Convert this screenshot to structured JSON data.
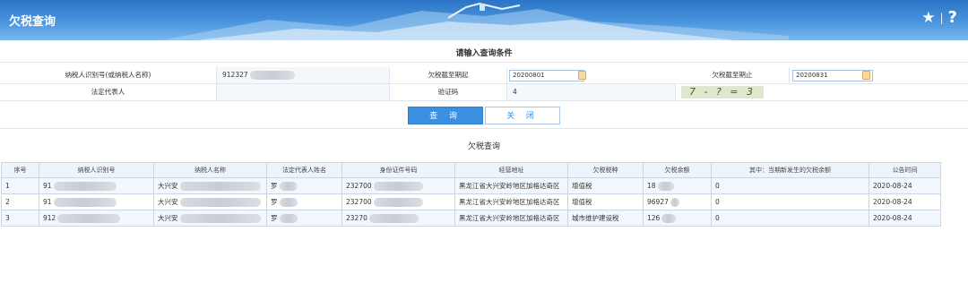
{
  "header": {
    "title": "欠税查询"
  },
  "query": {
    "section_title": "请输入查询条件",
    "taxpayer_id_label": "纳税人识别号(或纳税人名称)",
    "taxpayer_id_value": "912327",
    "date_from_label": "欠税截至期起",
    "date_from_value": "20200801",
    "date_to_label": "欠税截至期止",
    "date_to_value": "20200831",
    "legal_rep_label": "法定代表人",
    "legal_rep_value": "",
    "captcha_label": "验证码",
    "captcha_value": "4",
    "captcha_image_text": "7 - ? = 3"
  },
  "buttons": {
    "query": "查 询",
    "close": "关 闭"
  },
  "results": {
    "title": "欠税查询",
    "columns": [
      "序号",
      "纳税人识别号",
      "纳税人名称",
      "法定代表人姓名",
      "身份证件号码",
      "经营地址",
      "欠税税种",
      "欠税余额",
      "其中：当期新发生的欠税余额",
      "公告时间"
    ],
    "rows": [
      {
        "no": "1",
        "taxpayer_id": "91",
        "name": "大兴安",
        "legal_rep": "罗",
        "id_number": "232700",
        "address": "黑龙江省大兴安岭地区加格达奇区",
        "tax_type": "增值税",
        "balance": "18",
        "current_balance": "0",
        "date": "2020-08-24"
      },
      {
        "no": "2",
        "taxpayer_id": "91",
        "name": "大兴安",
        "legal_rep": "罗",
        "id_number": "232700",
        "address": "黑龙江省大兴安岭地区加格达奇区",
        "tax_type": "增值税",
        "balance": "96927",
        "current_balance": "0",
        "date": "2020-08-24"
      },
      {
        "no": "3",
        "taxpayer_id": "912",
        "name": "大兴安",
        "legal_rep": "罗",
        "id_number": "23270",
        "address": "黑龙江省大兴安岭地区加格达奇区",
        "tax_type": "城市维护建设税",
        "balance": "126",
        "current_balance": "0",
        "date": "2020-08-24"
      }
    ]
  },
  "icons": {
    "favorite": "star-icon",
    "help": "help-icon",
    "calendar": "calendar-icon"
  },
  "colors": {
    "header_blue": "#2a73c6",
    "button_blue": "#3b8fe0",
    "row_tint": "#f2f7fd"
  }
}
